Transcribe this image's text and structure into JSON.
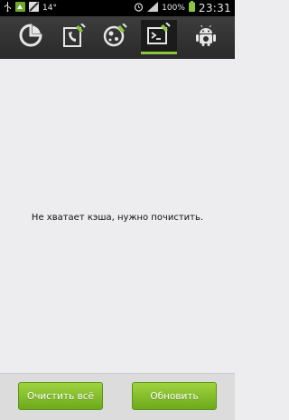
{
  "status_bar": {
    "temperature": "14°",
    "battery_percent": "100%",
    "time": "23:31"
  },
  "tabs": [
    {
      "icon": "pie-chart-icon",
      "active": false
    },
    {
      "icon": "phone-book-broom-icon",
      "active": false
    },
    {
      "icon": "globe-broom-icon",
      "active": false
    },
    {
      "icon": "terminal-broom-icon",
      "active": true
    },
    {
      "icon": "android-icon",
      "active": false
    }
  ],
  "main": {
    "message": "Не хватает кэша, нужно почистить."
  },
  "actions": {
    "clear_all_label": "Очистить всё",
    "refresh_label": "Обновить"
  },
  "colors": {
    "accent_green": "#8cc63f",
    "button_green_top": "#9fd33f",
    "button_green_bottom": "#6da91d"
  }
}
